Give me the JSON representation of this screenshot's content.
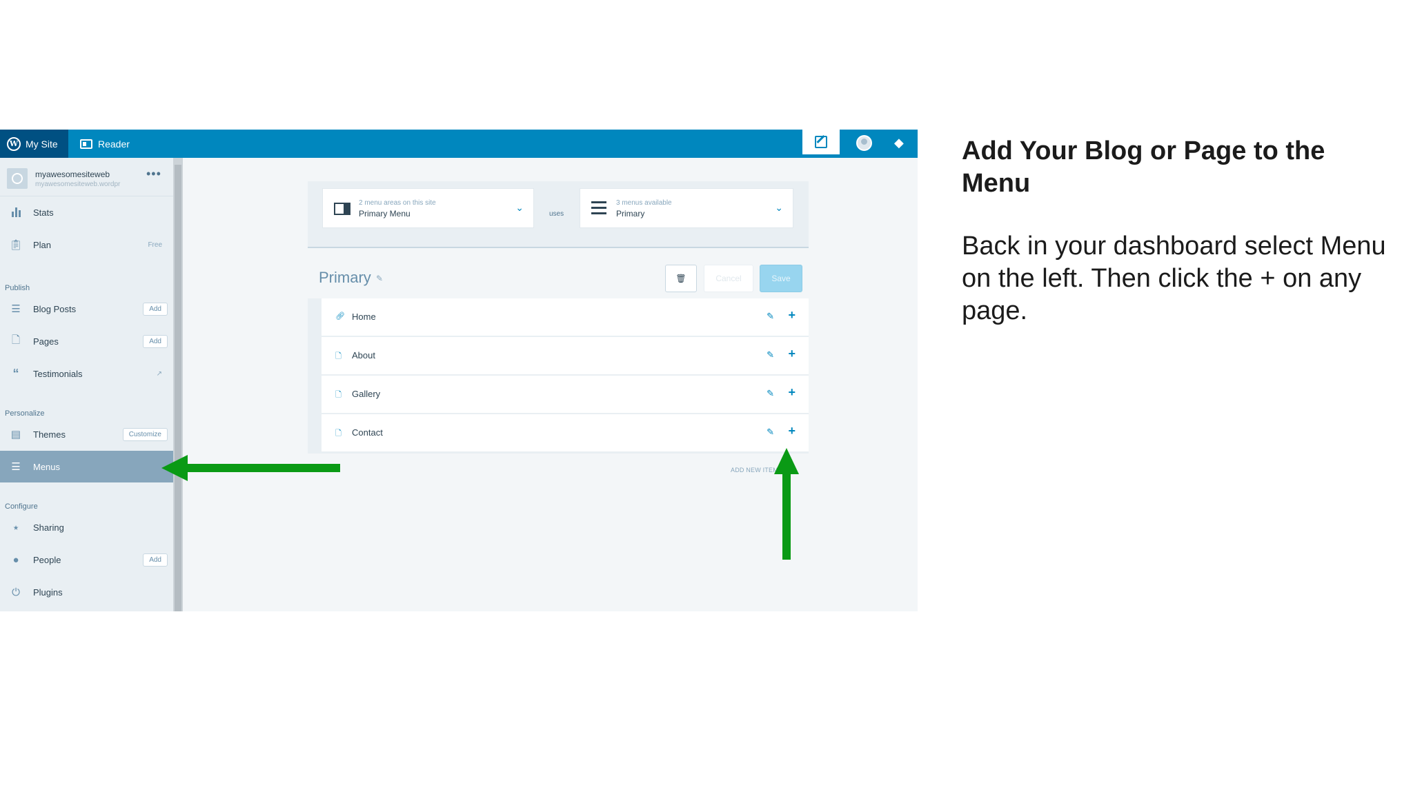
{
  "slide": {
    "title": "Add Your Blog or Page to the Menu",
    "body": "Back in your dashboard select Menu on the left. Then click the + on any page."
  },
  "topbar": {
    "mysite_label": "My Site",
    "reader_label": "Reader"
  },
  "site": {
    "name": "myawesomesiteweb",
    "url": "myawesomesiteweb.wordpr",
    "more": "•••"
  },
  "sidebar": {
    "stats": "Stats",
    "plan": "Plan",
    "plan_badge": "Free",
    "publish_head": "Publish",
    "blog_posts": "Blog Posts",
    "blog_posts_badge": "Add",
    "pages": "Pages",
    "pages_badge": "Add",
    "testimonials": "Testimonials",
    "personalize_head": "Personalize",
    "themes": "Themes",
    "themes_badge": "Customize",
    "menus": "Menus",
    "configure_head": "Configure",
    "sharing": "Sharing",
    "people": "People",
    "people_badge": "Add",
    "plugins": "Plugins"
  },
  "menu_selector": {
    "areas_small": "2 menu areas on this site",
    "areas_value": "Primary Menu",
    "uses": "uses",
    "menus_small": "3 menus available",
    "menus_value": "Primary"
  },
  "menu_editor": {
    "title": "Primary",
    "cancel": "Cancel",
    "save": "Save",
    "items": [
      "Home",
      "About",
      "Gallery",
      "Contact"
    ],
    "add_new": "ADD NEW ITEM"
  },
  "colors": {
    "topbar": "#0087be",
    "mysite": "#005082",
    "active_nav": "#87a6bc",
    "arrow": "#0a9a15"
  }
}
